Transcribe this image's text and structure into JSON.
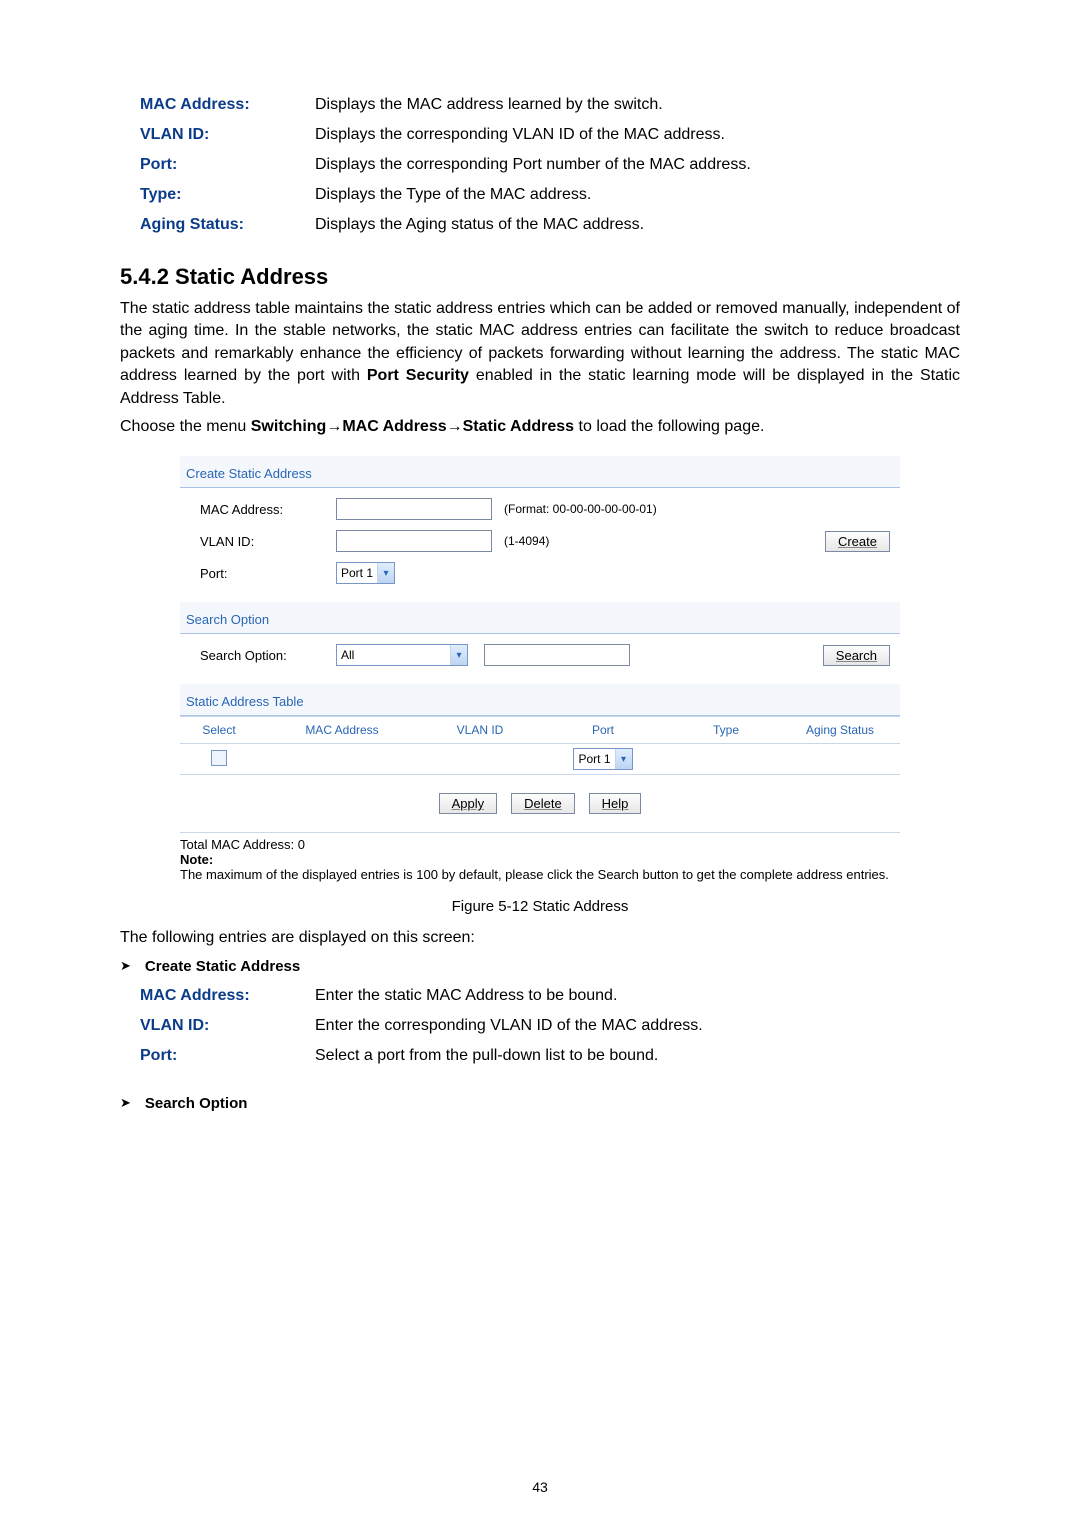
{
  "prev_defs": [
    {
      "term": "MAC Address:",
      "desc": "Displays the MAC address learned by the switch."
    },
    {
      "term": "VLAN ID:",
      "desc": "Displays the corresponding VLAN ID of the MAC address."
    },
    {
      "term": "Port:",
      "desc": "Displays the corresponding Port number of the MAC address."
    },
    {
      "term": "Type:",
      "desc": "Displays the Type of the MAC address."
    },
    {
      "term": "Aging Status:",
      "desc": "Displays the Aging status of the MAC address."
    }
  ],
  "section_heading": "5.4.2 Static Address",
  "para1_pre": "The static address table maintains the static address entries which can be added or removed manually, independent of the aging time. In the stable networks, the static MAC address entries can facilitate the switch to reduce broadcast packets and remarkably enhance the efficiency of packets forwarding without learning the address. The static MAC address learned by the port with ",
  "para1_bold": "Port Security",
  "para1_post": " enabled in the static learning mode will be displayed in the Static Address Table.",
  "menu_intro": "Choose the menu ",
  "menu_parts": [
    "Switching",
    "MAC Address",
    "Static Address"
  ],
  "menu_outro": " to load the following page.",
  "figure": {
    "create": {
      "title": "Create Static Address",
      "mac_label": "MAC Address:",
      "mac_hint": "(Format: 00-00-00-00-00-01)",
      "vlan_label": "VLAN ID:",
      "vlan_hint": "(1-4094)",
      "port_label": "Port:",
      "port_value": "Port 1",
      "create_btn": "Create"
    },
    "search": {
      "title": "Search Option",
      "label": "Search Option:",
      "value": "All",
      "btn": "Search"
    },
    "table": {
      "title": "Static Address Table",
      "headers": [
        "Select",
        "MAC Address",
        "VLAN ID",
        "Port",
        "Type",
        "Aging Status"
      ],
      "row_port": "Port 1"
    },
    "buttons": {
      "apply": "Apply",
      "delete": "Delete",
      "help": "Help"
    },
    "total": "Total MAC Address: 0",
    "note_hd": "Note:",
    "note": "The maximum of the displayed entries is 100 by default, please click the Search button to get the complete address entries."
  },
  "figure_caption": "Figure 5-12 Static Address",
  "entries_intro": "The following entries are displayed on this screen:",
  "bullet1": "Create Static Address",
  "defs2": [
    {
      "term": "MAC Address:",
      "desc": "Enter the static MAC Address to be bound."
    },
    {
      "term": "VLAN ID:",
      "desc": "Enter the corresponding VLAN ID of the MAC address."
    },
    {
      "term": "Port:",
      "desc": "Select a port from the pull-down list to be bound."
    }
  ],
  "bullet2": "Search Option",
  "page_number": "43"
}
